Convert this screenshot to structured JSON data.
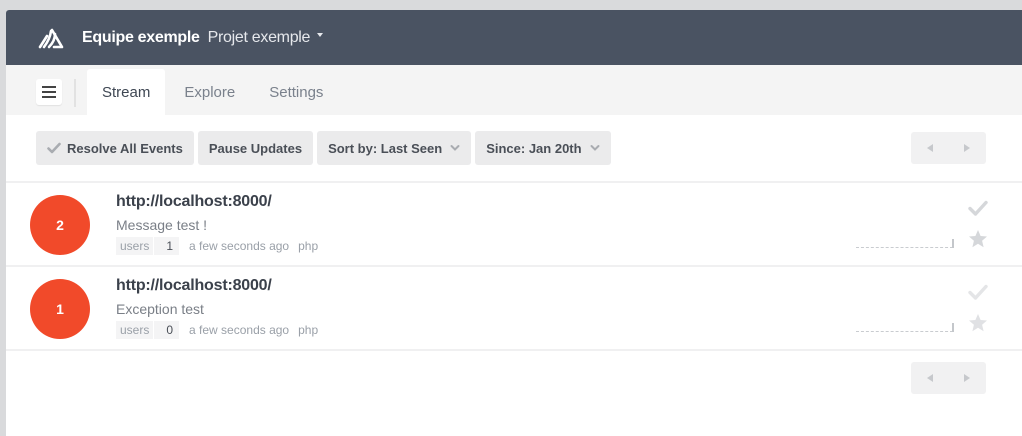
{
  "header": {
    "team": "Equipe exemple",
    "project": "Projet exemple"
  },
  "tabs": [
    {
      "label": "Stream",
      "active": true
    },
    {
      "label": "Explore",
      "active": false
    },
    {
      "label": "Settings",
      "active": false
    }
  ],
  "toolbar": {
    "resolve_all": "Resolve All Events",
    "pause": "Pause Updates",
    "sort": "Sort by: Last Seen",
    "since": "Since: Jan 20th"
  },
  "events": [
    {
      "count": "2",
      "title": "http://localhost:8000/",
      "message": "Message test !",
      "tag_key": "users",
      "tag_value": "1",
      "ago": "a few seconds ago",
      "platform": "php"
    },
    {
      "count": "1",
      "title": "http://localhost:8000/",
      "message": "Exception test",
      "tag_key": "users",
      "tag_value": "0",
      "ago": "a few seconds ago",
      "platform": "php"
    }
  ],
  "colors": {
    "header_bg": "#4a5362",
    "count_badge": "#f14a2a",
    "active_tab_bg": "#ffffff"
  },
  "icons": [
    "sentry-logo-icon",
    "hamburger-menu-icon",
    "check-icon",
    "chevron-down-icon",
    "arrow-left-icon",
    "arrow-right-icon",
    "star-icon"
  ]
}
